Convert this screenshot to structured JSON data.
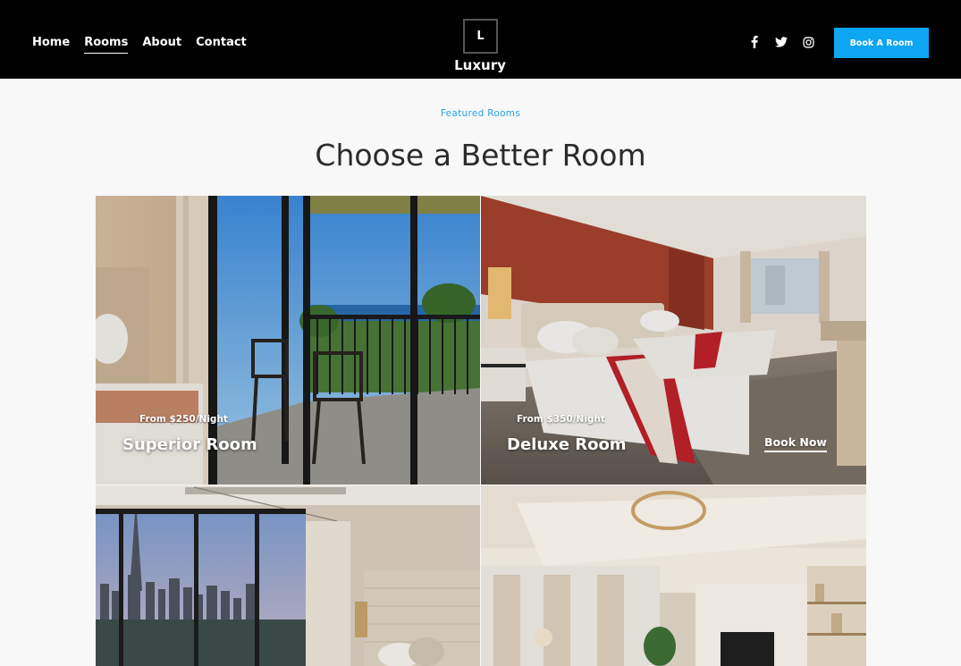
{
  "nav": {
    "items": [
      {
        "label": "Home",
        "active": false
      },
      {
        "label": "Rooms",
        "active": true
      },
      {
        "label": "About",
        "active": false
      },
      {
        "label": "Contact",
        "active": false
      }
    ]
  },
  "brand": {
    "mark": "L",
    "name": "Luxury"
  },
  "social": {
    "icons": [
      "facebook-icon",
      "twitter-icon",
      "instagram-icon"
    ]
  },
  "header": {
    "cta_label": "Book A Room",
    "cta_color": "#0ea5f3"
  },
  "section": {
    "eyebrow": "Featured Rooms",
    "title": "Choose a Better Room",
    "accent": "#2aa0e8"
  },
  "rooms": [
    {
      "price": "From $250/Night",
      "name": "Superior Room"
    },
    {
      "price": "From $350/Night",
      "name": "Deluxe Room",
      "action": "Book Now"
    },
    {
      "price": "",
      "name": ""
    },
    {
      "price": "",
      "name": ""
    }
  ]
}
